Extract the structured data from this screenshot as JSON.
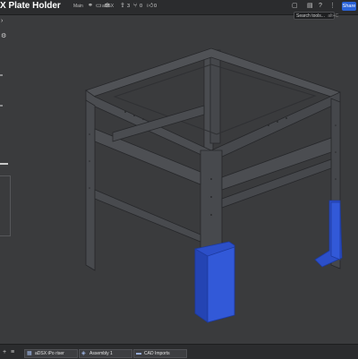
{
  "header": {
    "title": "X Plate Holder",
    "main_label": "Main",
    "workspace_label": "aDSX",
    "share_count": "3",
    "follow_count": "0",
    "like_count": "0",
    "search_placeholder": "Search tools...",
    "search_shortcut": "alt+C",
    "share_label": "Share"
  },
  "tabs": [
    {
      "label": "aDSX iPo riser"
    },
    {
      "label": "Assembly 1"
    },
    {
      "label": "CAD Imports"
    }
  ],
  "colors": {
    "frame": "#46484b",
    "frame_edge": "#2a2b2d",
    "holder_blue": "#2c4fc9"
  },
  "icons": {
    "share": "share-icon",
    "branch": "branch-icon",
    "copy": "copy-icon",
    "like": "thumbs-up-icon",
    "settings": "gear-icon"
  }
}
